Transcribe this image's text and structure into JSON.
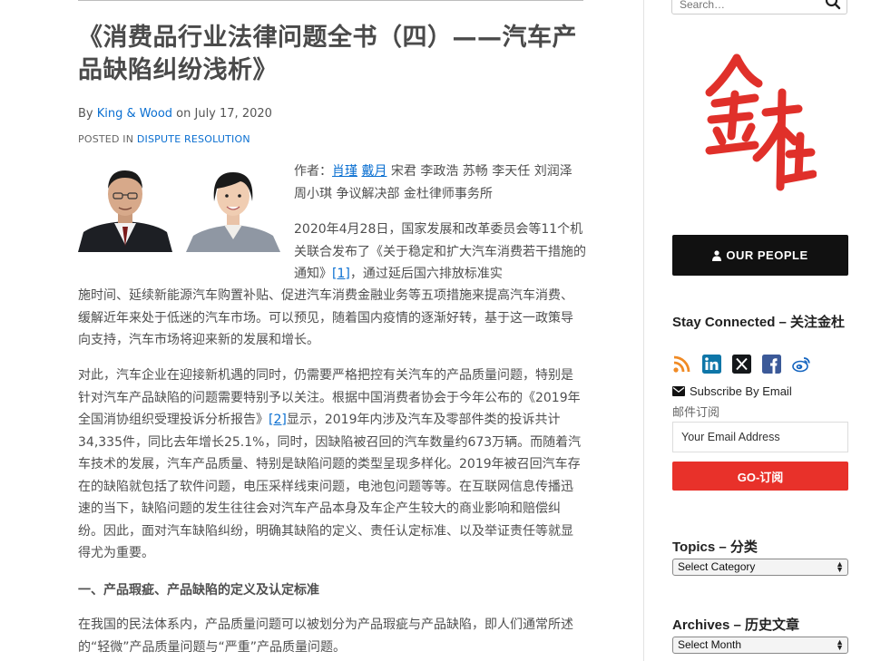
{
  "article": {
    "title": "《消费品行业法律问题全书（四）——汽车产品缺陷纠纷浅析》",
    "byline_prefix": "By ",
    "author": "King & Wood",
    "byline_on": " on ",
    "date": "July 17, 2020",
    "posted_in_label": "POSTED IN ",
    "category": "DISPUTE RESOLUTION",
    "authors_prefix": "作者：",
    "author_link_1": "肖瑾",
    "author_link_2": "戴月",
    "authors_rest": " 宋君 李政浩 苏畅 李天任 刘润泽 周小琪 争议解决部 金杜律师事务所",
    "intro_part_a": "2020年4月28日，国家发展和改革委员会等11个机关联合发布了《关于稳定和扩大汽车消费若干措施的通知》",
    "ref1": "[1]",
    "intro_part_a2": "，通过延后国六排放标准实",
    "intro_part_b": "施时间、延续新能源汽车购置补贴、促进汽车消费金融业务等五项措施来提高汽车消费、缓解近年来处于低迷的汽车市场。可以预见，随着国内疫情的逐渐好转，基于这一政策导向支持，汽车市场将迎来新的发展和增长。",
    "p2_a": "对此，汽车企业在迎接新机遇的同时，仍需要严格把控有关汽车的产品质量问题，特别是针对汽车产品缺陷的问题需要特别予以关注。根据中国消费者协会于今年公布的《2019年全国消协组织受理投诉分析报告》",
    "ref2": "[2]",
    "p2_b": "显示，2019年内涉及汽车及零部件类的投诉共计34,335件，同比去年增长25.1%，同时，因缺陷被召回的汽车数量约673万辆。而随着汽车技术的发展，汽车产品质量、特别是缺陷问题的类型呈现多样化。2019年被召回汽车存在的缺陷就包括了软件问题，电压采样线束问题，电池包问题等等。在互联网信息传播迅速的当下，缺陷问题的发生往往会对汽车产品本身及车企产生较大的商业影响和赔偿纠纷。因此，面对汽车缺陷纠纷，明确其缺陷的定义、责任认定标准、以及举证责任等就显得尤为重要。",
    "section1_heading": "一、产品瑕疵、产品缺陷的定义及认定标准",
    "p3": "在我国的民法体系内，产品质量问题可以被划分为产品瑕疵与产品缺陷，即人们通常所述的“轻微”产品质量问题与“严重”产品质量问题。"
  },
  "sidebar": {
    "search_placeholder": "Search…",
    "logo_text": "金杜",
    "our_people": "OUR PEOPLE",
    "stay_connected": "Stay Connected – 关注金杜",
    "social_icons": [
      "rss-icon",
      "linkedin-icon",
      "x-icon",
      "facebook-icon",
      "weibo-icon"
    ],
    "subscribe": "Subscribe By Email",
    "mail_label": "邮件订阅",
    "email_placeholder": "Your Email Address",
    "go_button": "GO-订阅",
    "topics_heading": "Topics – 分类",
    "topics_select": "Select Category",
    "archives_heading": "Archives – 历史文章",
    "archives_select": "Select Month"
  },
  "colors": {
    "link": "#0a6fd1",
    "brand_red": "#e8312a",
    "button_dark": "#111111"
  }
}
